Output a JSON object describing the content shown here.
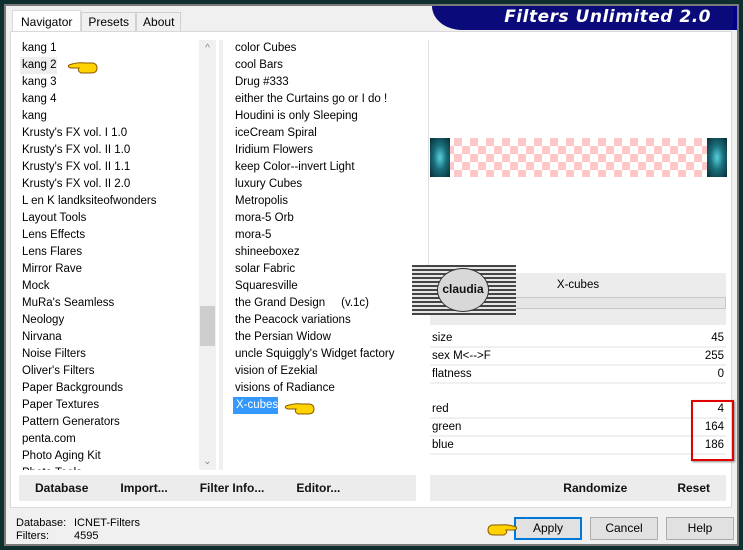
{
  "app": {
    "title": "Filters Unlimited 2.0"
  },
  "tabs": [
    {
      "label": "Navigator",
      "active": true
    },
    {
      "label": "Presets",
      "active": false
    },
    {
      "label": "About",
      "active": false
    }
  ],
  "categories": [
    "kang 1",
    "kang 2",
    "kang 3",
    "kang 4",
    "kang",
    "Krusty's FX vol. I 1.0",
    "Krusty's FX vol. II 1.0",
    "Krusty's FX vol. II 1.1",
    "Krusty's FX vol. II 2.0",
    "L en K landksiteofwonders",
    "Layout Tools",
    "Lens Effects",
    "Lens Flares",
    "Mirror Rave",
    "Mock",
    "MuRa's Seamless",
    "Neology",
    "Nirvana",
    "Noise Filters",
    "Oliver's Filters",
    "Paper Backgrounds",
    "Paper Textures",
    "Pattern Generators",
    "penta.com",
    "Photo Aging Kit",
    "Photo Tools"
  ],
  "hovered_category": "kang 2",
  "filters": [
    "color Cubes",
    "cool Bars",
    "Drug #333",
    "either the Curtains go or I do !",
    "Houdini is only Sleeping",
    "iceCream Spiral",
    "Iridium Flowers",
    "keep Color--invert Light",
    "luxury Cubes",
    "Metropolis",
    "mora-5 Orb",
    "mora-5",
    "shineeboxez",
    "solar Fabric",
    "Squaresville",
    "the Grand Design     (v.1c)",
    "the Peacock variations",
    "the Persian Widow",
    "uncle Squiggly's Widget factory",
    "vision of Ezekial",
    "visions of Radiance",
    "X-cubes"
  ],
  "selected_filter": "X-cubes",
  "preview": {
    "filter_name": "X-cubes",
    "watermark": "claudia"
  },
  "params": [
    {
      "label": "size",
      "value": "45"
    },
    {
      "label": "sex  M<-->F",
      "value": "255"
    },
    {
      "label": "flatness",
      "value": "0"
    }
  ],
  "params_color": [
    {
      "label": "red",
      "value": "4"
    },
    {
      "label": "green",
      "value": "164"
    },
    {
      "label": "blue",
      "value": "186"
    }
  ],
  "left_buttons": {
    "database": "Database",
    "import": "Import...",
    "filter_info": "Filter Info...",
    "editor": "Editor..."
  },
  "right_buttons": {
    "randomize": "Randomize",
    "reset": "Reset"
  },
  "status": {
    "database_label": "Database:",
    "database_value": "ICNET-Filters",
    "filters_label": "Filters:",
    "filters_value": "4595"
  },
  "dialog_buttons": {
    "apply": "Apply",
    "cancel": "Cancel",
    "help": "Help"
  },
  "colors": {
    "selection": "#3399ff",
    "highlight_box": "#e00000",
    "title_bg": "#0a0a7a",
    "default_button_border": "#0078d7"
  }
}
